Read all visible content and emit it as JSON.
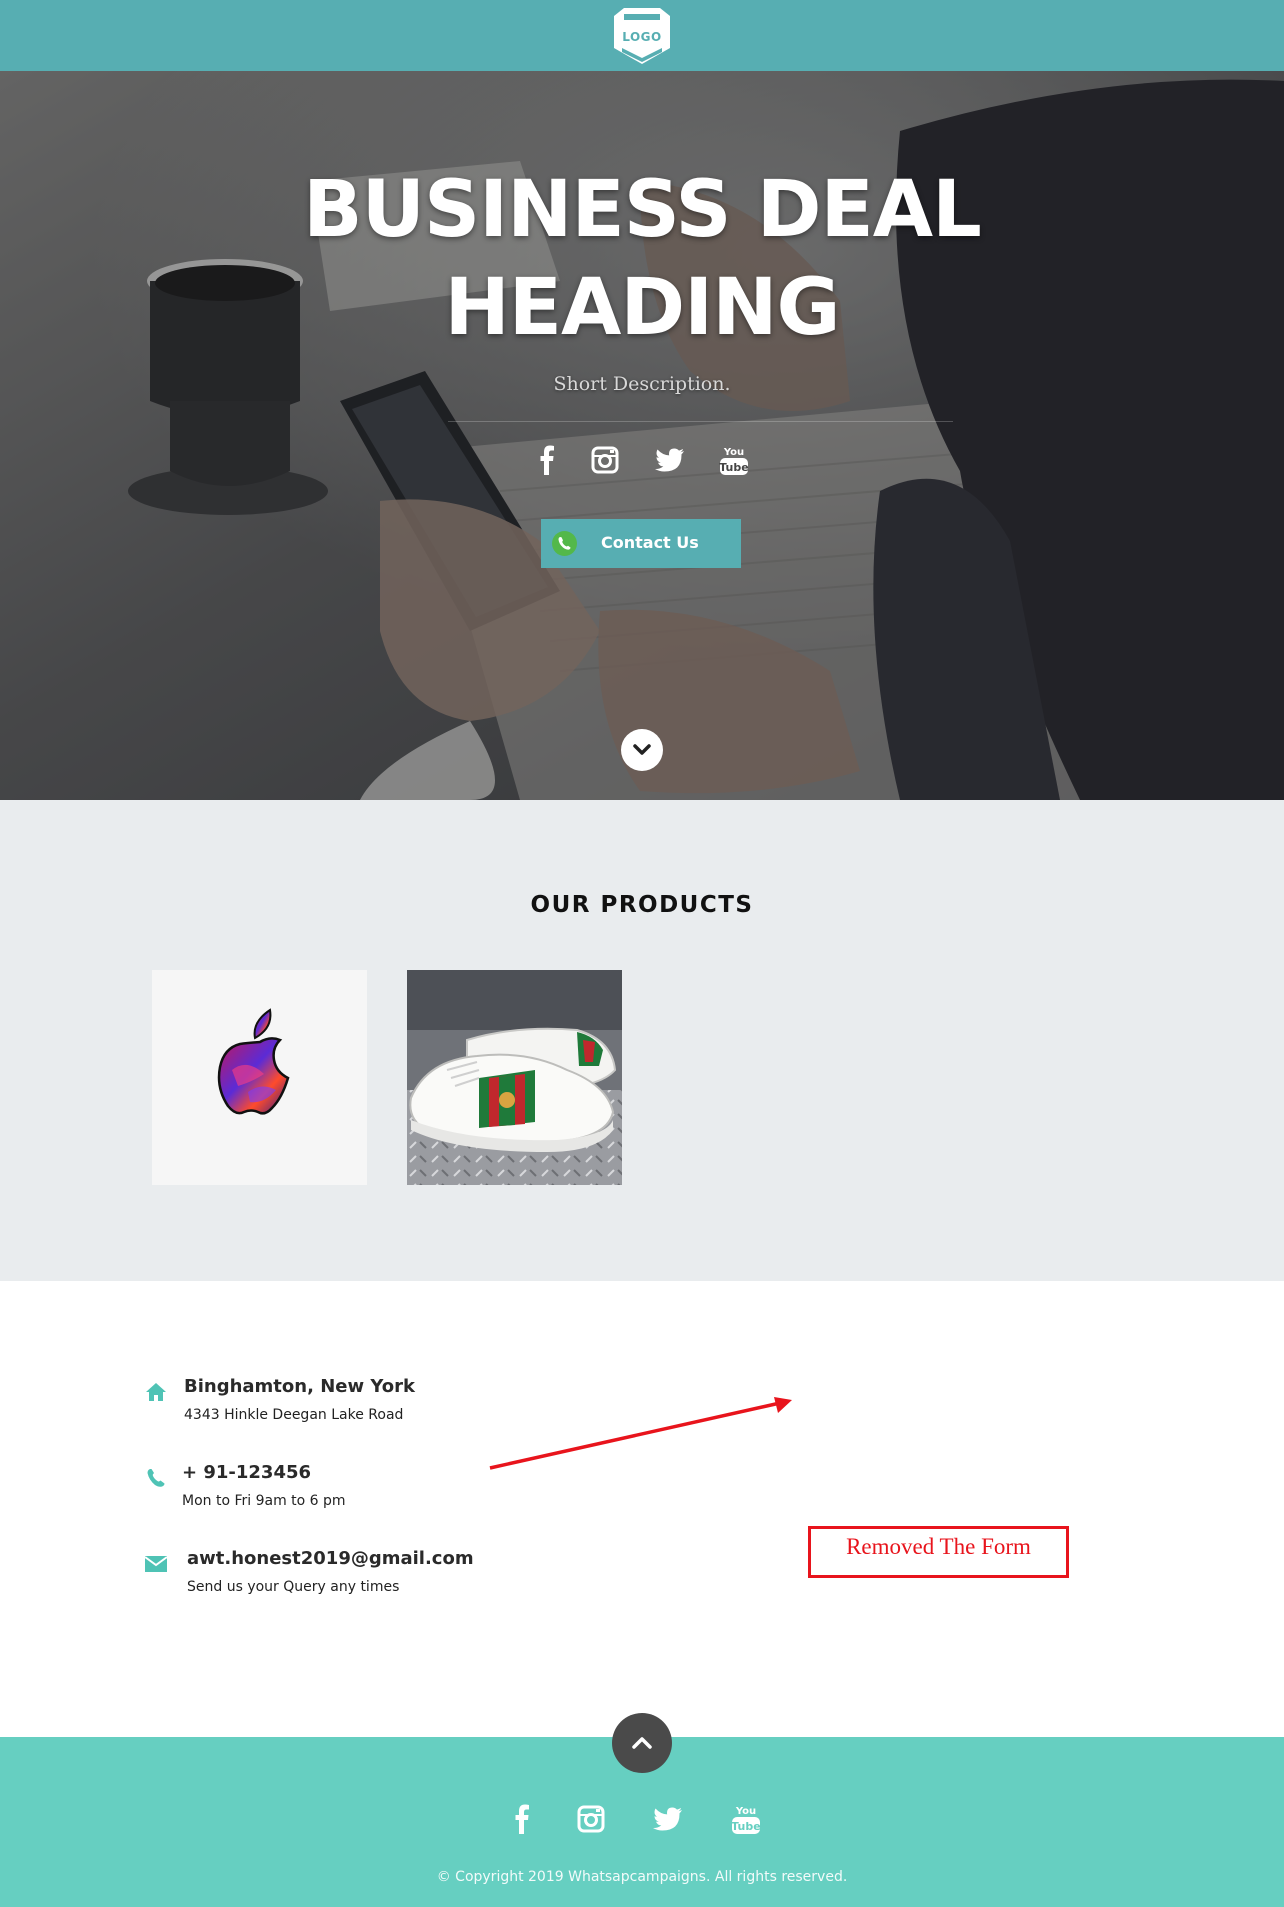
{
  "navbar": {
    "logo_text": "LOGO"
  },
  "hero": {
    "title_line1": "BUSINESS DEAL",
    "title_line2": "HEADING",
    "subtitle": "Short Description.",
    "social_icons": [
      "facebook-icon",
      "instagram-icon",
      "twitter-icon",
      "youtube-icon"
    ],
    "contact_button": {
      "label": "Contact Us",
      "icon": "whatsapp-icon"
    },
    "scroll_icon": "chevron-down-icon"
  },
  "products": {
    "title": "OUR PRODUCTS",
    "items": [
      {
        "icon": "apple-logo-image"
      },
      {
        "icon": "sneaker-image"
      }
    ]
  },
  "contact": {
    "address": {
      "icon": "home-icon",
      "title": "Binghamton, New York",
      "detail": "4343 Hinkle Deegan Lake Road"
    },
    "phone": {
      "icon": "phone-icon",
      "title": "+ 91-123456",
      "detail": "Mon to Fri 9am to 6 pm"
    },
    "email": {
      "icon": "envelope-icon",
      "title": "awt.honest2019@gmail.com",
      "detail": "Send us your Query any times"
    },
    "annotation": {
      "text": "Removed The Form",
      "color": "#e8141c"
    }
  },
  "footer": {
    "copyright": "© Copyright 2019 Whatsapcampaigns. All rights reserved.",
    "social_icons": [
      "facebook-icon",
      "instagram-icon",
      "twitter-icon",
      "youtube-icon"
    ],
    "top_icon": "chevron-up-icon"
  },
  "colors": {
    "brand_teal": "#57aeb2",
    "footer_teal": "#66cfc1",
    "contact_icon_teal": "#4fc3b5",
    "products_bg": "#e9ecee",
    "whatsapp_green": "#53b84a"
  }
}
